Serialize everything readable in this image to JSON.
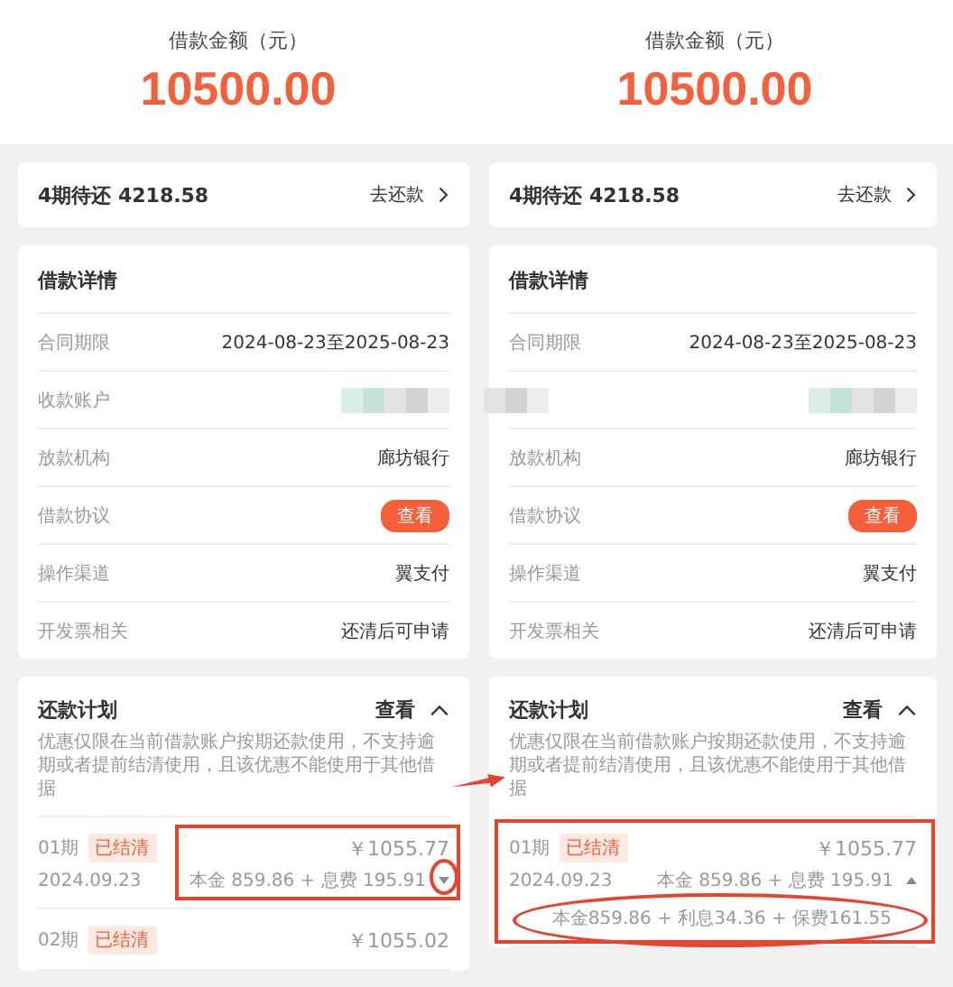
{
  "panels": [
    {
      "amount": {
        "label": "借款金额（元）",
        "value": "10500.00"
      },
      "pending": {
        "text": "4期待还 4218.58",
        "action": "去还款"
      },
      "details": {
        "title": "借款详情",
        "rows": [
          {
            "kind": "text",
            "label": "合同期限",
            "value": "2024-08-23至2025-08-23"
          },
          {
            "kind": "masked",
            "label": "收款账户"
          },
          {
            "kind": "text",
            "label": "放款机构",
            "value": "廊坊银行"
          },
          {
            "kind": "button",
            "label": "借款协议",
            "value": "查看"
          },
          {
            "kind": "text",
            "label": "操作渠道",
            "value": "翼支付"
          },
          {
            "kind": "text",
            "label": "开发票相关",
            "value": "还清后可申请"
          }
        ]
      },
      "plan": {
        "title": "还款计划",
        "action": "查看",
        "expanded": true,
        "note": "优惠仅限在当前借款账户按期还款使用，不支持逾期或者提前结清使用，且该优惠不能使用于其他借据",
        "installments": [
          {
            "period": "01期",
            "status": "已结清",
            "amount": "￥1055.77",
            "date": "2024.09.23",
            "summary": "本金 859.86 + 息费 195.91",
            "expanded": false,
            "boxed_amount": true
          },
          {
            "period": "02期",
            "status": "已结清",
            "amount": "￥1055.02"
          }
        ]
      }
    },
    {
      "amount": {
        "label": "借款金额（元）",
        "value": "10500.00"
      },
      "pending": {
        "text": "4期待还 4218.58",
        "action": "去还款"
      },
      "details": {
        "title": "借款详情",
        "rows": [
          {
            "kind": "text",
            "label": "合同期限",
            "value": "2024-08-23至2025-08-23"
          },
          {
            "kind": "masked"
          },
          {
            "kind": "text",
            "label": "放款机构",
            "value": "廊坊银行"
          },
          {
            "kind": "button",
            "label": "借款协议",
            "value": "查看"
          },
          {
            "kind": "text",
            "label": "操作渠道",
            "value": "翼支付"
          },
          {
            "kind": "text",
            "label": "开发票相关",
            "value": "还清后可申请"
          }
        ]
      },
      "plan": {
        "title": "还款计划",
        "action": "查看",
        "expanded": true,
        "note": "优惠仅限在当前借款账户按期还款使用，不支持逾期或者提前结清使用，且该优惠不能使用于其他借据",
        "installments": [
          {
            "period": "01期",
            "status": "已结清",
            "amount": "￥1055.77",
            "date": "2024.09.23",
            "summary": "本金 859.86 + 息费 195.91",
            "expanded": true,
            "breakdown": "本金859.86 + 利息34.36 + 保费161.55",
            "boxed_row": true
          }
        ]
      }
    }
  ],
  "arrow": true
}
